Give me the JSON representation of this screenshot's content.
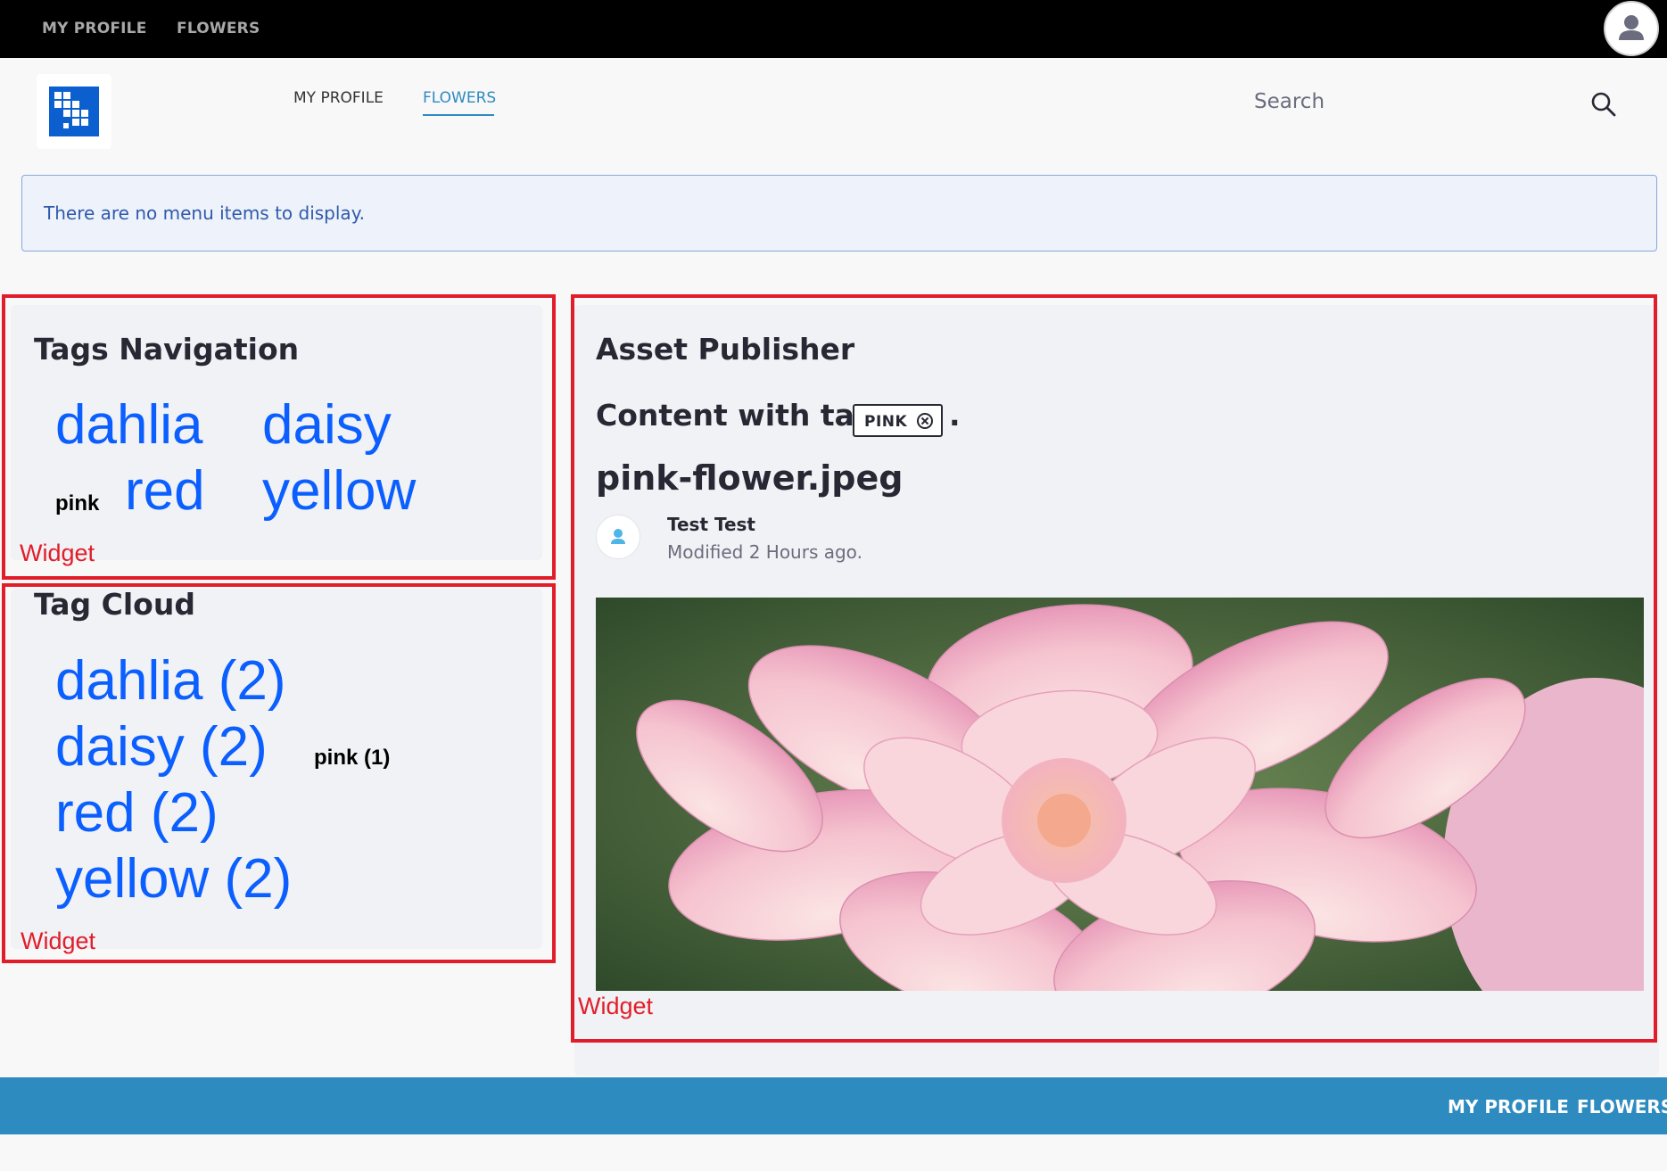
{
  "top_bar": {
    "nav": [
      "MY PROFILE",
      "FLOWERS"
    ],
    "avatar_icon": "user-icon",
    "bg_color": "#000000"
  },
  "header": {
    "logo_icon": "site-logo-icon",
    "nav": [
      {
        "label": "MY PROFILE",
        "active": false
      },
      {
        "label": "FLOWERS",
        "active": true
      }
    ],
    "search": {
      "placeholder": "Search",
      "value": ""
    },
    "search_icon": "search-icon"
  },
  "alert": {
    "message": "There are no menu items to display."
  },
  "widgets": {
    "label": "Widget",
    "tags_navigation": {
      "title": "Tags Navigation",
      "tags": [
        "dahlia",
        "daisy",
        "pink",
        "red",
        "yellow"
      ]
    },
    "tag_cloud": {
      "title": "Tag Cloud",
      "tags": [
        "dahlia (2)",
        "daisy (2)",
        "pink (1)",
        "red (2)",
        "yellow (2)"
      ]
    },
    "asset_publisher": {
      "title": "Asset Publisher",
      "filter_prefix": "Content with tag",
      "filter_tag": "PINK",
      "filter_suffix": ".",
      "asset_title": "pink-flower.jpeg",
      "author": "Test Test",
      "modified": "Modified 2 Hours ago.",
      "image_subject": "pink dahlia flower"
    }
  },
  "footer": {
    "nav": [
      "MY PROFILE",
      "FLOWERS"
    ],
    "bg_color": "#2e8bc0"
  },
  "colors": {
    "accent": "#2e8bc0",
    "link": "#0b5fff",
    "annotation": "#e11d2a",
    "alert_text": "#2e5aac"
  }
}
